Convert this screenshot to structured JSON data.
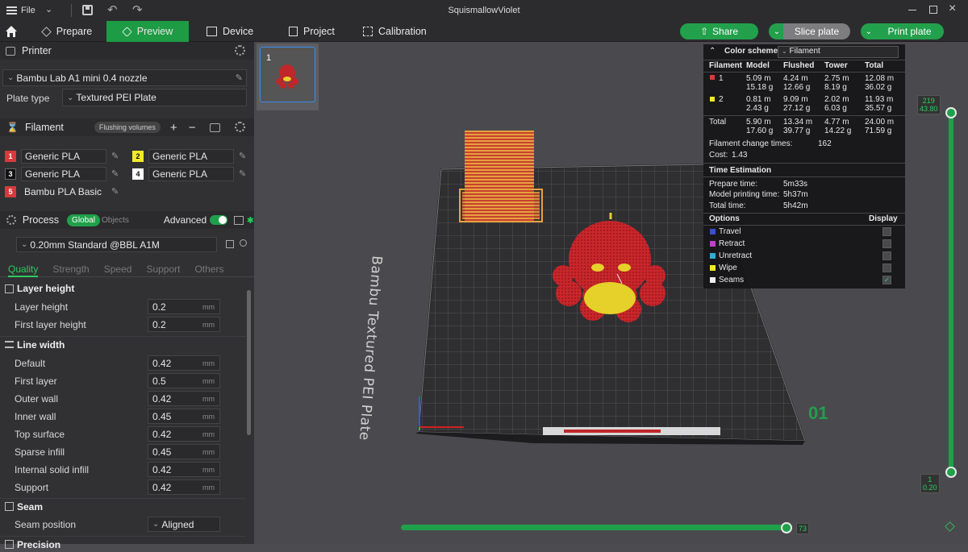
{
  "titlebar": {
    "file_label": "File",
    "project_name": "SquismallowViolet"
  },
  "navbar": {
    "tabs": [
      {
        "label": "Prepare"
      },
      {
        "label": "Preview"
      },
      {
        "label": "Device"
      },
      {
        "label": "Project"
      },
      {
        "label": "Calibration"
      }
    ],
    "share_label": "Share",
    "slice_label": "Slice plate",
    "print_label": "Print plate"
  },
  "printer": {
    "header": "Printer",
    "model": "Bambu Lab A1 mini 0.4 nozzle",
    "plate_type_label": "Plate type",
    "plate_type": "Textured PEI Plate"
  },
  "filament": {
    "header": "Filament",
    "flushing_label": "Flushing volumes",
    "items": [
      {
        "num": "1",
        "name": "Generic PLA",
        "color": "#d8393c"
      },
      {
        "num": "2",
        "name": "Generic PLA",
        "color": "#f2ea29"
      },
      {
        "num": "3",
        "name": "Generic PLA",
        "color": "#111111"
      },
      {
        "num": "4",
        "name": "Generic PLA",
        "color": "#ffffff"
      },
      {
        "num": "5",
        "name": "Bambu PLA Basic",
        "color": "#d8393c"
      }
    ]
  },
  "process": {
    "header": "Process",
    "global_label": "Global",
    "objects_label": "Objects",
    "advanced_label": "Advanced",
    "advanced_on": true,
    "preset": "0.20mm Standard @BBL A1M",
    "tabs": [
      "Quality",
      "Strength",
      "Speed",
      "Support",
      "Others"
    ],
    "active_tab": "Quality",
    "groups": {
      "layer_height": {
        "title": "Layer height",
        "rows": [
          {
            "label": "Layer height",
            "value": "0.2",
            "unit": "mm"
          },
          {
            "label": "First layer height",
            "value": "0.2",
            "unit": "mm"
          }
        ]
      },
      "line_width": {
        "title": "Line width",
        "rows": [
          {
            "label": "Default",
            "value": "0.42",
            "unit": "mm"
          },
          {
            "label": "First layer",
            "value": "0.5",
            "unit": "mm"
          },
          {
            "label": "Outer wall",
            "value": "0.42",
            "unit": "mm"
          },
          {
            "label": "Inner wall",
            "value": "0.45",
            "unit": "mm"
          },
          {
            "label": "Top surface",
            "value": "0.42",
            "unit": "mm"
          },
          {
            "label": "Sparse infill",
            "value": "0.45",
            "unit": "mm"
          },
          {
            "label": "Internal solid infill",
            "value": "0.42",
            "unit": "mm"
          },
          {
            "label": "Support",
            "value": "0.42",
            "unit": "mm"
          }
        ]
      },
      "seam": {
        "title": "Seam",
        "rows": [
          {
            "label": "Seam position",
            "value": "Aligned"
          }
        ]
      },
      "precision": {
        "title": "Precision"
      }
    }
  },
  "viewport": {
    "plate_thumb_num": "1",
    "plate_label": "Bambu Textured PEI Plate",
    "plate_number": "01",
    "layer_top_num": "219",
    "layer_top_height": "43.80",
    "layer_bottom_num": "1",
    "layer_bottom_height": "0.20",
    "move_value": "73"
  },
  "stats": {
    "color_scheme_label": "Color scheme",
    "color_scheme_value": "Filament",
    "headers": [
      "Filament",
      "Model",
      "Flushed",
      "Tower",
      "Total"
    ],
    "rows": [
      {
        "id": "1",
        "color": "#d8393c",
        "model_m": "5.09 m",
        "model_g": "15.18 g",
        "flushed_m": "4.24 m",
        "flushed_g": "12.66 g",
        "tower_m": "2.75 m",
        "tower_g": "8.19 g",
        "total_m": "12.08 m",
        "total_g": "36.02 g"
      },
      {
        "id": "2",
        "color": "#f2ea29",
        "model_m": "0.81 m",
        "model_g": "2.43 g",
        "flushed_m": "9.09 m",
        "flushed_g": "27.12 g",
        "tower_m": "2.02 m",
        "tower_g": "6.03 g",
        "total_m": "11.93 m",
        "total_g": "35.57 g"
      }
    ],
    "total_row": {
      "label": "Total",
      "model_m": "5.90 m",
      "model_g": "17.60 g",
      "flushed_m": "13.34 m",
      "flushed_g": "39.77 g",
      "tower_m": "4.77 m",
      "tower_g": "14.22 g",
      "total_m": "24.00 m",
      "total_g": "71.59 g"
    },
    "change_times_label": "Filament change times:",
    "change_times": "162",
    "cost_label": "Cost:",
    "cost": "1.43",
    "time_header": "Time Estimation",
    "prepare_label": "Prepare time:",
    "prepare_value": "5m33s",
    "model_time_label": "Model printing time:",
    "model_time_value": "5h37m",
    "total_time_label": "Total time:",
    "total_time_value": "5h42m",
    "options_label": "Options",
    "display_label": "Display",
    "options": [
      {
        "label": "Travel",
        "color": "#3a4fd0",
        "checked": false
      },
      {
        "label": "Retract",
        "color": "#c040c8",
        "checked": false
      },
      {
        "label": "Unretract",
        "color": "#2ab0d8",
        "checked": false
      },
      {
        "label": "Wipe",
        "color": "#f2ea29",
        "checked": false
      },
      {
        "label": "Seams",
        "color": "#eeeeee",
        "checked": true
      }
    ]
  }
}
